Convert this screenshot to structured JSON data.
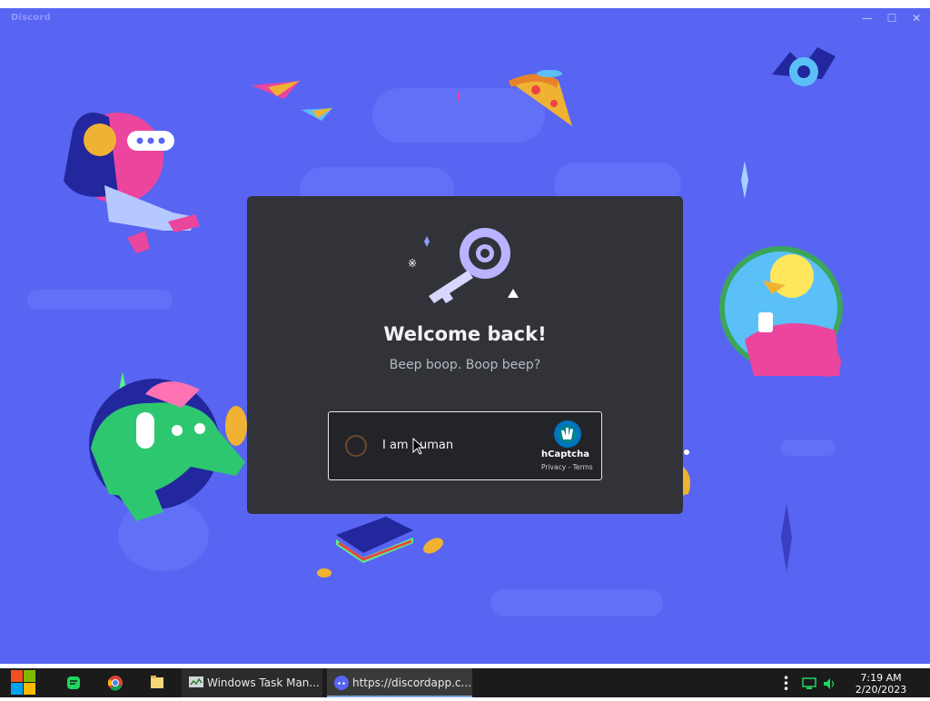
{
  "window": {
    "title": "Discord"
  },
  "login": {
    "title": "Welcome back!",
    "subtitle": "Beep boop. Boop beep?"
  },
  "captcha": {
    "label": "I am human",
    "brand": "hCaptcha",
    "links": "Privacy - Terms"
  },
  "taskbar": {
    "apps": [
      {
        "label": "Windows Task Man...",
        "icon": "task-manager-icon"
      },
      {
        "label": "https://discordapp.c...",
        "icon": "discord-icon"
      }
    ],
    "pinned": [
      "windows-start-icon",
      "chat-icon",
      "chrome-icon",
      "file-explorer-icon"
    ],
    "clock": {
      "time": "7:19 AM",
      "date": "2/20/2023"
    }
  },
  "colors": {
    "blurple": "#5865f2",
    "card": "#313338",
    "taskbar": "#1b1b1b"
  }
}
